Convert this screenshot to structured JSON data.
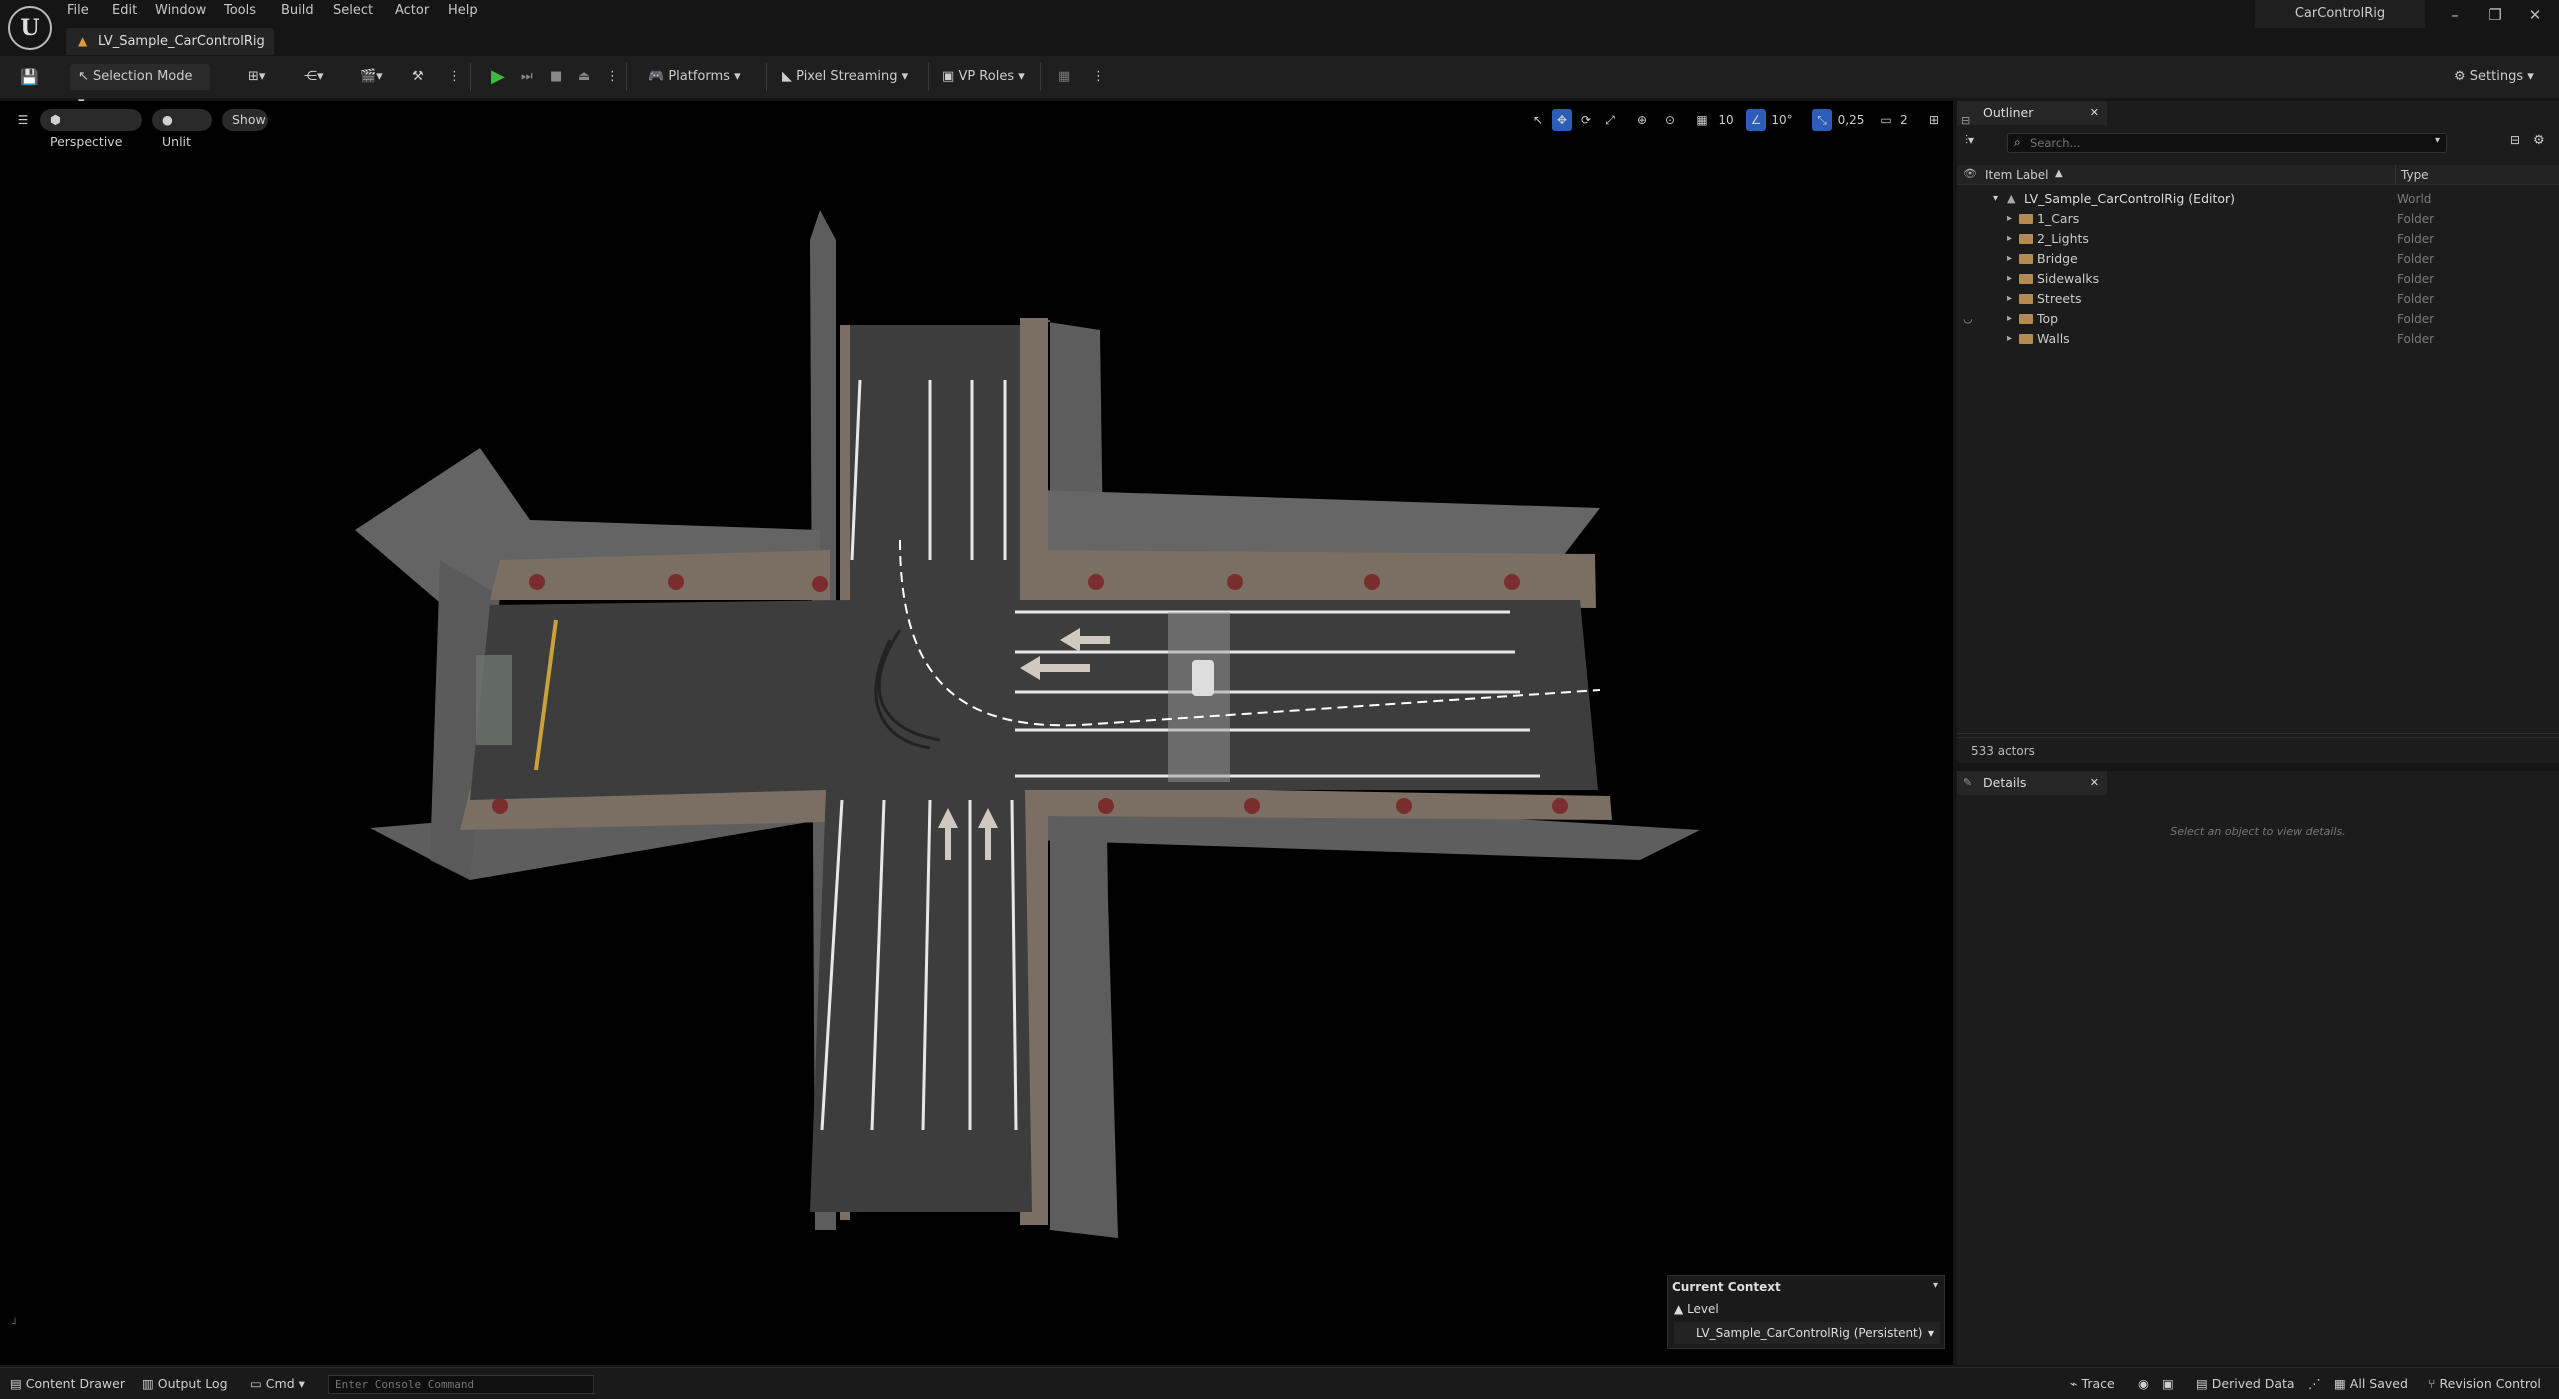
{
  "app": {
    "title": "CarControlRig",
    "doc_tab": "LV_Sample_CarControlRig",
    "logo_glyph": "U"
  },
  "menu": [
    "File",
    "Edit",
    "Window",
    "Tools",
    "Build",
    "Select",
    "Actor",
    "Help"
  ],
  "toolbar": {
    "selection_mode": "Selection Mode",
    "platforms": "Platforms",
    "pixel_streaming": "Pixel Streaming",
    "vp_roles": "VP Roles",
    "settings": "Settings",
    "play_color": "#3cbb3c"
  },
  "viewport": {
    "view_mode": "Perspective",
    "lighting": "Unlit",
    "show": "Show",
    "grid_size": "10",
    "rotation_snap": "10°",
    "scale_snap": "0,25",
    "camera_speed": "2",
    "context": {
      "header": "Current Context",
      "label": "Level",
      "value": "LV_Sample_CarControlRig (Persistent)"
    }
  },
  "outliner": {
    "tab": "Outliner",
    "search_placeholder": "Search...",
    "col_label": "Item Label",
    "col_type": "Type",
    "world": {
      "label": "LV_Sample_CarControlRig (Editor)",
      "type": "World"
    },
    "folders": [
      {
        "label": "1_Cars",
        "type": "Folder"
      },
      {
        "label": "2_Lights",
        "type": "Folder"
      },
      {
        "label": "Bridge",
        "type": "Folder"
      },
      {
        "label": "Sidewalks",
        "type": "Folder"
      },
      {
        "label": "Streets",
        "type": "Folder"
      },
      {
        "label": "Top",
        "type": "Folder"
      },
      {
        "label": "Walls",
        "type": "Folder"
      }
    ],
    "actor_count": "533 actors"
  },
  "details": {
    "tab": "Details",
    "empty_msg": "Select an object to view details."
  },
  "statusbar": {
    "content_drawer": "Content Drawer",
    "output_log": "Output Log",
    "cmd": "Cmd",
    "console_placeholder": "Enter Console Command",
    "trace": "Trace",
    "derived_data": "Derived Data",
    "all_saved": "All Saved",
    "revision_control": "Revision Control"
  }
}
